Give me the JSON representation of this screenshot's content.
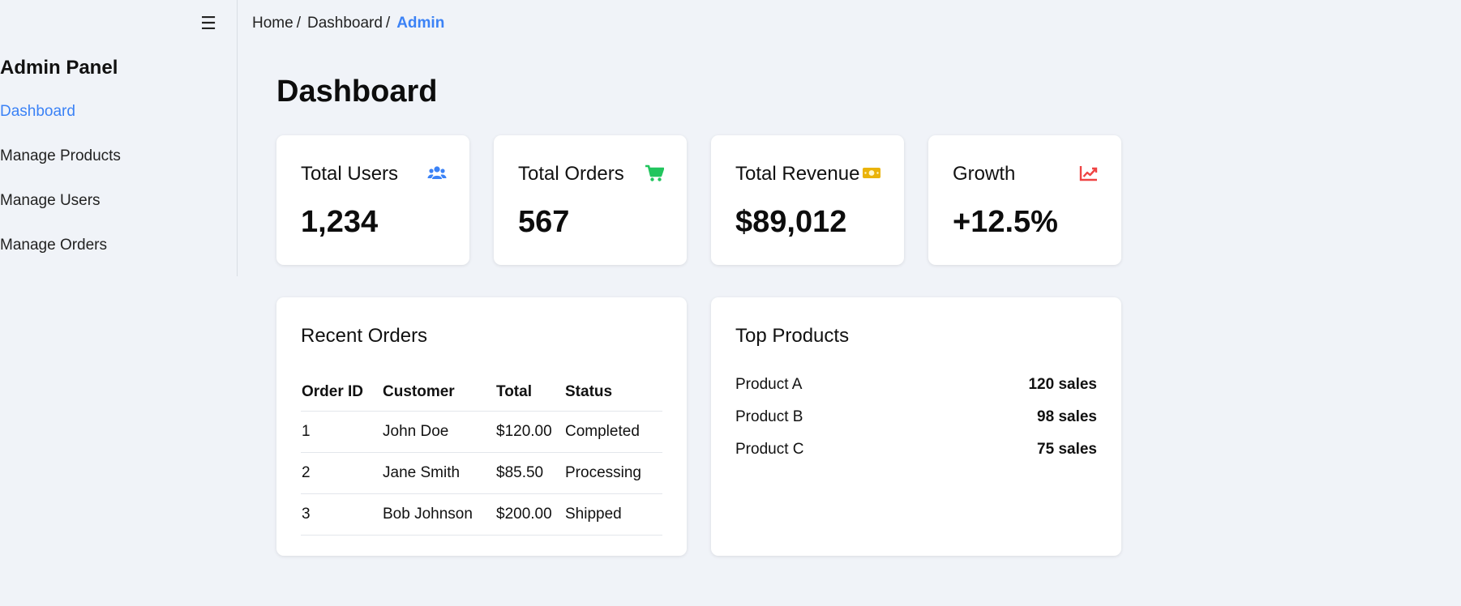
{
  "sidebar": {
    "menu_icon": "☰",
    "brand": "Admin Panel",
    "items": [
      {
        "label": "Dashboard"
      },
      {
        "label": "Manage Products"
      },
      {
        "label": "Manage Users"
      },
      {
        "label": "Manage Orders"
      }
    ],
    "active_color": "#3b82f6"
  },
  "breadcrumb": {
    "items": [
      "Home",
      "Dashboard"
    ],
    "separator": "/",
    "current": "Admin"
  },
  "page": {
    "title": "Dashboard"
  },
  "stats": [
    {
      "label": "Total Users",
      "value": "1,234",
      "icon": "users-icon",
      "color": "#3b82f6"
    },
    {
      "label": "Total Orders",
      "value": "567",
      "icon": "shopping-cart-icon",
      "color": "#22c55e"
    },
    {
      "label": "Total Revenue",
      "value": "$89,012",
      "icon": "money-bill-icon",
      "color": "#eab308"
    },
    {
      "label": "Growth",
      "value": "+12.5%",
      "icon": "chart-line-icon",
      "color": "#ef4444"
    }
  ],
  "recent_orders": {
    "title": "Recent Orders",
    "columns": [
      "Order ID",
      "Customer",
      "Total",
      "Status"
    ],
    "rows": [
      [
        "1",
        "John Doe",
        "$120.00",
        "Completed"
      ],
      [
        "2",
        "Jane Smith",
        "$85.50",
        "Processing"
      ],
      [
        "3",
        "Bob Johnson",
        "$200.00",
        "Shipped"
      ]
    ]
  },
  "top_products": {
    "title": "Top Products",
    "items": [
      {
        "name": "Product A",
        "sales": "120 sales"
      },
      {
        "name": "Product B",
        "sales": "98 sales"
      },
      {
        "name": "Product C",
        "sales": "75 sales"
      }
    ]
  }
}
